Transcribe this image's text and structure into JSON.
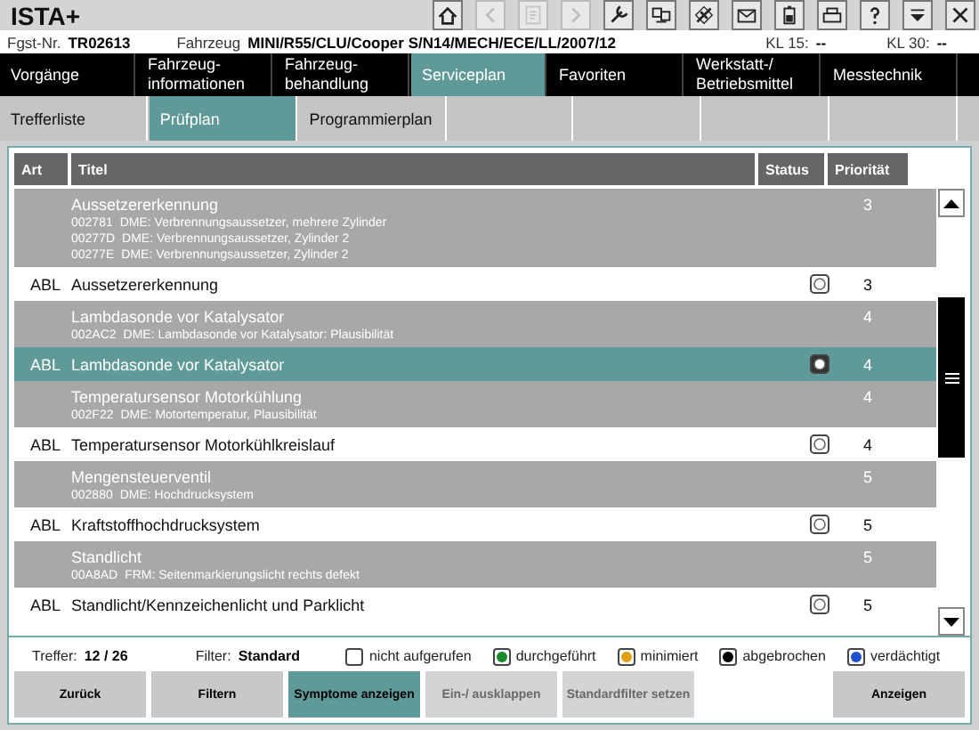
{
  "app_title": "ISTA+",
  "toolbar": [
    {
      "kind": "home",
      "disabled": false
    },
    {
      "kind": "back",
      "disabled": true
    },
    {
      "kind": "document",
      "disabled": true
    },
    {
      "kind": "forward",
      "disabled": true
    },
    {
      "kind": "wrench",
      "disabled": false
    },
    {
      "kind": "screens",
      "disabled": false
    },
    {
      "kind": "plug",
      "disabled": false
    },
    {
      "kind": "mail",
      "disabled": false
    },
    {
      "kind": "battery",
      "disabled": false
    },
    {
      "kind": "printer",
      "disabled": false
    },
    {
      "kind": "help",
      "disabled": false
    },
    {
      "kind": "dropdown",
      "disabled": false
    },
    {
      "kind": "close",
      "disabled": false
    }
  ],
  "info_bar": {
    "vin_label": "Fgst-Nr.",
    "vin": "TR02613",
    "vehicle_label": "Fahrzeug",
    "vehicle": "MINI/R55/CLU/Cooper S/N14/MECH/ECE/LL/2007/12",
    "kl15_label": "KL 15:",
    "kl15": "--",
    "kl30_label": "KL 30:",
    "kl30": "--"
  },
  "main_tabs": [
    {
      "label": "Vorgänge",
      "selected": false
    },
    {
      "label": "Fahrzeug-\ninformationen",
      "selected": false
    },
    {
      "label": "Fahrzeug-\nbehandlung",
      "selected": false
    },
    {
      "label": "Serviceplan",
      "selected": true
    },
    {
      "label": "Favoriten",
      "selected": false
    },
    {
      "label": "Werkstatt-/\nBetriebsmittel",
      "selected": false
    },
    {
      "label": "Messtechnik",
      "selected": false
    }
  ],
  "sub_tabs": [
    {
      "label": "Trefferliste",
      "selected": false
    },
    {
      "label": "Prüfplan",
      "selected": true
    },
    {
      "label": "Programmierplan",
      "selected": false
    }
  ],
  "table": {
    "columns": [
      "Art",
      "Titel",
      "Status",
      "Priorität"
    ],
    "rows": [
      {
        "kind": "group",
        "title": "Aussetzererkennung",
        "priority": "3",
        "codes": [
          {
            "code": "002781",
            "text": "DME: Verbrennungsaussetzer, mehrere Zylinder"
          },
          {
            "code": "00277D",
            "text": "DME: Verbrennungsaussetzer, Zylinder 2"
          },
          {
            "code": "00277E",
            "text": "DME: Verbrennungsaussetzer, Zylinder 2"
          }
        ]
      },
      {
        "kind": "test",
        "art": "ABL",
        "title": "Aussetzererkennung",
        "color": "#ffffff",
        "priority": "3",
        "selected": false
      },
      {
        "kind": "group",
        "title": "Lambdasonde vor Katalysator",
        "priority": "4",
        "codes": [
          {
            "code": "002AC2",
            "text": "DME: Lambdasonde vor Katalysator: Plausibilität"
          }
        ]
      },
      {
        "kind": "test",
        "art": "ABL",
        "title": "Lambdasonde vor Katalysator",
        "color": "#ffffff",
        "priority": "4",
        "selected": true
      },
      {
        "kind": "group",
        "title": "Temperatursensor Motorkühlung",
        "priority": "4",
        "codes": [
          {
            "code": "002F22",
            "text": "DME: Motortemperatur, Plausibilität"
          }
        ]
      },
      {
        "kind": "test",
        "art": "ABL",
        "title": "Temperatursensor Motorkühlkreislauf",
        "color": "#ffffff",
        "priority": "4",
        "selected": false
      },
      {
        "kind": "group",
        "title": "Mengensteuerventil",
        "priority": "5",
        "codes": [
          {
            "code": "002880",
            "text": "DME: Hochdrucksystem"
          }
        ]
      },
      {
        "kind": "test",
        "art": "ABL",
        "title": "Kraftstoffhochdrucksystem",
        "color": "#ffffff",
        "priority": "5",
        "selected": false
      },
      {
        "kind": "group",
        "title": "Standlicht",
        "priority": "5",
        "codes": [
          {
            "code": "00A8AD",
            "text": "FRM: Seitenmarkierungslicht rechts defekt"
          }
        ]
      },
      {
        "kind": "test",
        "art": "ABL",
        "title": "Standlicht/Kennzeichenlicht und Parklicht",
        "color": "#ffffff",
        "priority": "5",
        "selected": false
      }
    ]
  },
  "summary": {
    "hits_label": "Treffer:",
    "hits": "12 / 26",
    "filter_label": "Filter:",
    "filter": "Standard"
  },
  "legend": [
    {
      "label": "nicht aufgerufen",
      "color": "#ffffff"
    },
    {
      "label": "durchgeführt",
      "color": "#1a8a2a"
    },
    {
      "label": "minimiert",
      "color": "#e0a010"
    },
    {
      "label": "abgebrochen",
      "color": "#000000"
    },
    {
      "label": "verdächtigt",
      "color": "#2050d0"
    }
  ],
  "buttons": [
    {
      "label": "Zurück",
      "selected": false,
      "disabled": false
    },
    {
      "label": "Filtern",
      "selected": false,
      "disabled": false
    },
    {
      "label": "Symptome anzeigen",
      "selected": true,
      "disabled": false
    },
    {
      "label": "Ein-/ ausklappen",
      "selected": false,
      "disabled": true
    },
    {
      "label": "Standardfilter setzen",
      "selected": false,
      "disabled": true
    },
    {
      "label": "Anzeigen",
      "selected": false,
      "disabled": false
    }
  ]
}
